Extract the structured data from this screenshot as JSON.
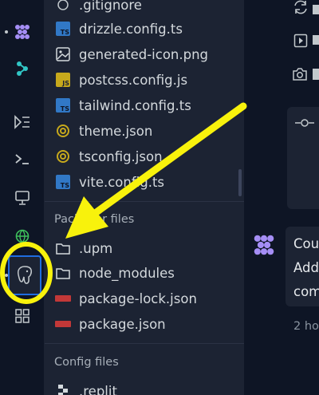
{
  "files_top": [
    {
      "name": ".gitignore",
      "icon": "git-icon"
    },
    {
      "name": "drizzle.config.ts",
      "icon": "typescript-icon"
    },
    {
      "name": "generated-icon.png",
      "icon": "image-icon"
    },
    {
      "name": "postcss.config.js",
      "icon": "javascript-icon"
    },
    {
      "name": "tailwind.config.ts",
      "icon": "typescript-icon"
    },
    {
      "name": "theme.json",
      "icon": "json-icon"
    },
    {
      "name": "tsconfig.json",
      "icon": "json-icon"
    },
    {
      "name": "vite.config.ts",
      "icon": "typescript-icon"
    }
  ],
  "packager": {
    "title": "Packager files",
    "items": [
      {
        "name": ".upm",
        "icon": "folder-icon"
      },
      {
        "name": "node_modules",
        "icon": "folder-icon"
      },
      {
        "name": "package-lock.json",
        "icon": "npm-icon"
      },
      {
        "name": "package.json",
        "icon": "npm-icon"
      }
    ]
  },
  "config": {
    "title": "Config files",
    "items": [
      {
        "name": ".replit",
        "icon": "replit-icon"
      }
    ]
  },
  "chat": {
    "message_lines": [
      "Cou",
      "Add",
      "com"
    ],
    "timestamp": "2 ho"
  },
  "annotation": {
    "arrow_color": "#f8f20c",
    "circle_color": "#f8f20c"
  },
  "colors": {
    "bg": "#0e1525",
    "panel": "#1c2333",
    "ts": "#3178c6",
    "js": "#c7a91c",
    "npm": "#c23838",
    "agent": "#a58ef5"
  }
}
